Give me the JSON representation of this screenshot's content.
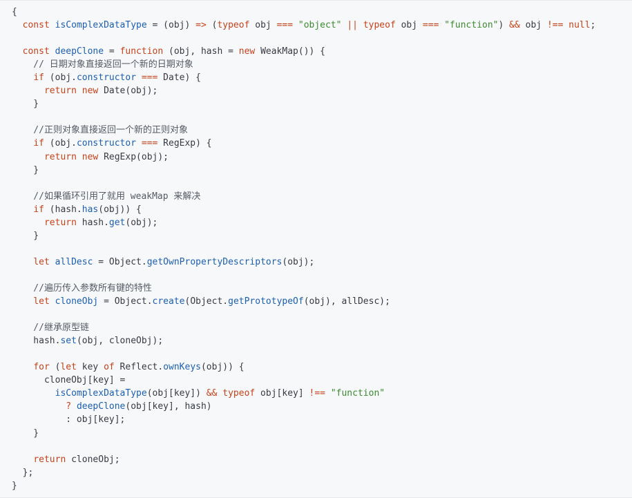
{
  "colors": {
    "background": "#f7f8fa",
    "keyword": "#c4421a",
    "string": "#3c8a2e",
    "function": "#1c5fae",
    "comment": "#555a63",
    "text": "#383a42"
  },
  "code": {
    "language": "javascript",
    "lines": [
      [
        {
          "t": "p",
          "v": "{"
        }
      ],
      [
        {
          "t": "p",
          "v": "  "
        },
        {
          "t": "k",
          "v": "const"
        },
        {
          "t": "p",
          "v": " "
        },
        {
          "t": "f",
          "v": "isComplexDataType"
        },
        {
          "t": "p",
          "v": " = (obj) "
        },
        {
          "t": "k",
          "v": "=>"
        },
        {
          "t": "p",
          "v": " ("
        },
        {
          "t": "k",
          "v": "typeof"
        },
        {
          "t": "p",
          "v": " obj "
        },
        {
          "t": "k",
          "v": "==="
        },
        {
          "t": "p",
          "v": " "
        },
        {
          "t": "s",
          "v": "\"object\""
        },
        {
          "t": "p",
          "v": " "
        },
        {
          "t": "k",
          "v": "||"
        },
        {
          "t": "p",
          "v": " "
        },
        {
          "t": "k",
          "v": "typeof"
        },
        {
          "t": "p",
          "v": " obj "
        },
        {
          "t": "k",
          "v": "==="
        },
        {
          "t": "p",
          "v": " "
        },
        {
          "t": "s",
          "v": "\"function\""
        },
        {
          "t": "p",
          "v": ") "
        },
        {
          "t": "k",
          "v": "&&"
        },
        {
          "t": "p",
          "v": " obj "
        },
        {
          "t": "k",
          "v": "!=="
        },
        {
          "t": "p",
          "v": " "
        },
        {
          "t": "k",
          "v": "null"
        },
        {
          "t": "p",
          "v": ";"
        }
      ],
      [],
      [
        {
          "t": "p",
          "v": "  "
        },
        {
          "t": "k",
          "v": "const"
        },
        {
          "t": "p",
          "v": " "
        },
        {
          "t": "f",
          "v": "deepClone"
        },
        {
          "t": "p",
          "v": " = "
        },
        {
          "t": "k",
          "v": "function"
        },
        {
          "t": "p",
          "v": " (obj, hash = "
        },
        {
          "t": "k",
          "v": "new"
        },
        {
          "t": "p",
          "v": " WeakMap()) {"
        }
      ],
      [
        {
          "t": "c",
          "v": "    // 日期对象直接返回一个新的日期对象"
        }
      ],
      [
        {
          "t": "p",
          "v": "    "
        },
        {
          "t": "k",
          "v": "if"
        },
        {
          "t": "p",
          "v": " (obj."
        },
        {
          "t": "f",
          "v": "constructor"
        },
        {
          "t": "p",
          "v": " "
        },
        {
          "t": "k",
          "v": "==="
        },
        {
          "t": "p",
          "v": " Date) {"
        }
      ],
      [
        {
          "t": "p",
          "v": "      "
        },
        {
          "t": "k",
          "v": "return"
        },
        {
          "t": "p",
          "v": " "
        },
        {
          "t": "k",
          "v": "new"
        },
        {
          "t": "p",
          "v": " Date(obj);"
        }
      ],
      [
        {
          "t": "p",
          "v": "    }"
        }
      ],
      [],
      [
        {
          "t": "c",
          "v": "    //正则对象直接返回一个新的正则对象"
        }
      ],
      [
        {
          "t": "p",
          "v": "    "
        },
        {
          "t": "k",
          "v": "if"
        },
        {
          "t": "p",
          "v": " (obj."
        },
        {
          "t": "f",
          "v": "constructor"
        },
        {
          "t": "p",
          "v": " "
        },
        {
          "t": "k",
          "v": "==="
        },
        {
          "t": "p",
          "v": " RegExp) {"
        }
      ],
      [
        {
          "t": "p",
          "v": "      "
        },
        {
          "t": "k",
          "v": "return"
        },
        {
          "t": "p",
          "v": " "
        },
        {
          "t": "k",
          "v": "new"
        },
        {
          "t": "p",
          "v": " RegExp(obj);"
        }
      ],
      [
        {
          "t": "p",
          "v": "    }"
        }
      ],
      [],
      [
        {
          "t": "c",
          "v": "    //如果循环引用了就用 weakMap 来解决"
        }
      ],
      [
        {
          "t": "p",
          "v": "    "
        },
        {
          "t": "k",
          "v": "if"
        },
        {
          "t": "p",
          "v": " (hash."
        },
        {
          "t": "f",
          "v": "has"
        },
        {
          "t": "p",
          "v": "(obj)) {"
        }
      ],
      [
        {
          "t": "p",
          "v": "      "
        },
        {
          "t": "k",
          "v": "return"
        },
        {
          "t": "p",
          "v": " hash."
        },
        {
          "t": "f",
          "v": "get"
        },
        {
          "t": "p",
          "v": "(obj);"
        }
      ],
      [
        {
          "t": "p",
          "v": "    }"
        }
      ],
      [],
      [
        {
          "t": "p",
          "v": "    "
        },
        {
          "t": "k",
          "v": "let"
        },
        {
          "t": "p",
          "v": " "
        },
        {
          "t": "f",
          "v": "allDesc"
        },
        {
          "t": "p",
          "v": " = Object."
        },
        {
          "t": "f",
          "v": "getOwnPropertyDescriptors"
        },
        {
          "t": "p",
          "v": "(obj);"
        }
      ],
      [],
      [
        {
          "t": "c",
          "v": "    //遍历传入参数所有键的特性"
        }
      ],
      [
        {
          "t": "p",
          "v": "    "
        },
        {
          "t": "k",
          "v": "let"
        },
        {
          "t": "p",
          "v": " "
        },
        {
          "t": "f",
          "v": "cloneObj"
        },
        {
          "t": "p",
          "v": " = Object."
        },
        {
          "t": "f",
          "v": "create"
        },
        {
          "t": "p",
          "v": "(Object."
        },
        {
          "t": "f",
          "v": "getPrototypeOf"
        },
        {
          "t": "p",
          "v": "(obj), allDesc);"
        }
      ],
      [],
      [
        {
          "t": "c",
          "v": "    //继承原型链"
        }
      ],
      [
        {
          "t": "p",
          "v": "    hash."
        },
        {
          "t": "f",
          "v": "set"
        },
        {
          "t": "p",
          "v": "(obj, cloneObj);"
        }
      ],
      [],
      [
        {
          "t": "p",
          "v": "    "
        },
        {
          "t": "k",
          "v": "for"
        },
        {
          "t": "p",
          "v": " ("
        },
        {
          "t": "k",
          "v": "let"
        },
        {
          "t": "p",
          "v": " key "
        },
        {
          "t": "k",
          "v": "of"
        },
        {
          "t": "p",
          "v": " Reflect."
        },
        {
          "t": "f",
          "v": "ownKeys"
        },
        {
          "t": "p",
          "v": "(obj)) {"
        }
      ],
      [
        {
          "t": "p",
          "v": "      cloneObj[key] ="
        }
      ],
      [
        {
          "t": "p",
          "v": "        "
        },
        {
          "t": "f",
          "v": "isComplexDataType"
        },
        {
          "t": "p",
          "v": "(obj[key]) "
        },
        {
          "t": "k",
          "v": "&&"
        },
        {
          "t": "p",
          "v": " "
        },
        {
          "t": "k",
          "v": "typeof"
        },
        {
          "t": "p",
          "v": " obj[key] "
        },
        {
          "t": "k",
          "v": "!=="
        },
        {
          "t": "p",
          "v": " "
        },
        {
          "t": "s",
          "v": "\"function\""
        }
      ],
      [
        {
          "t": "p",
          "v": "          "
        },
        {
          "t": "k",
          "v": "?"
        },
        {
          "t": "p",
          "v": " "
        },
        {
          "t": "f",
          "v": "deepClone"
        },
        {
          "t": "p",
          "v": "(obj[key], hash)"
        }
      ],
      [
        {
          "t": "p",
          "v": "          : obj[key];"
        }
      ],
      [
        {
          "t": "p",
          "v": "    }"
        }
      ],
      [],
      [
        {
          "t": "p",
          "v": "    "
        },
        {
          "t": "k",
          "v": "return"
        },
        {
          "t": "p",
          "v": " cloneObj;"
        }
      ],
      [
        {
          "t": "p",
          "v": "  };"
        }
      ],
      [
        {
          "t": "p",
          "v": "}"
        }
      ]
    ]
  }
}
